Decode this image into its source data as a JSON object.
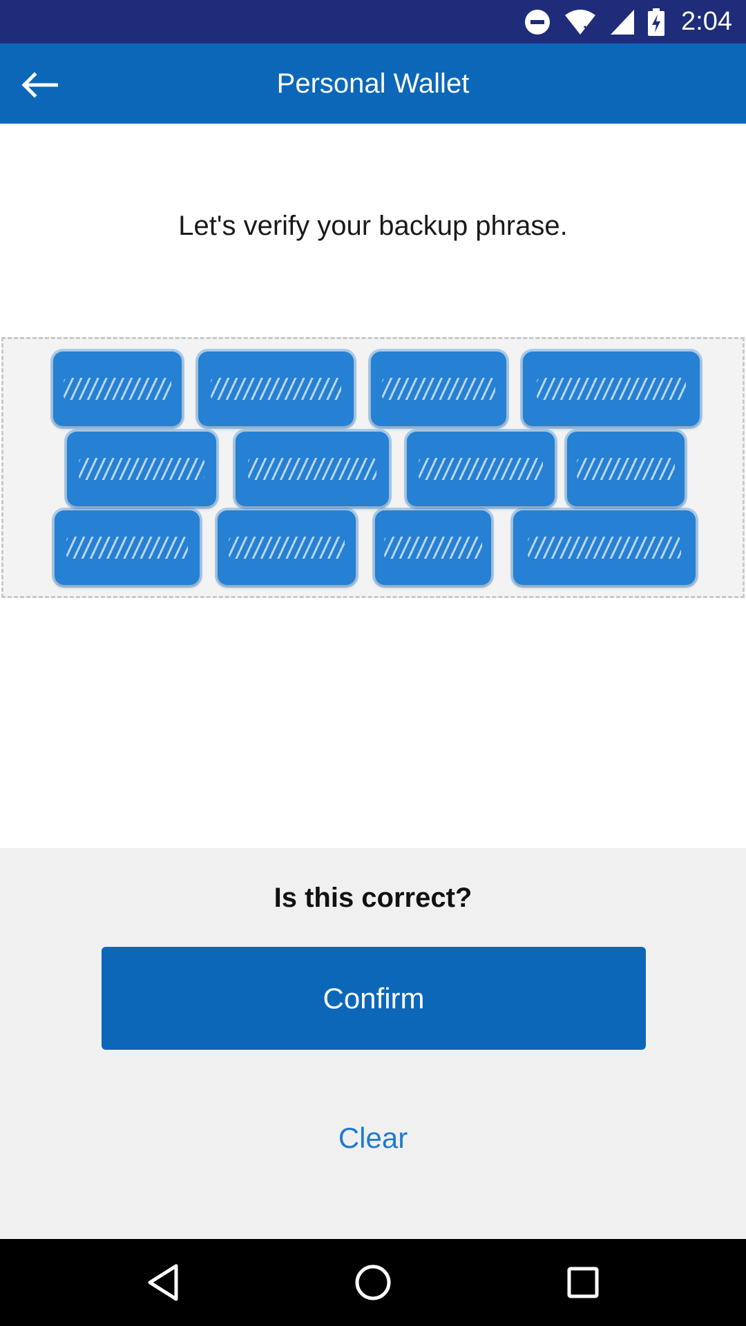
{
  "status_bar": {
    "time": "2:04",
    "icons": [
      "do-not-disturb-icon",
      "wifi-icon",
      "signal-icon",
      "battery-charging-icon"
    ]
  },
  "app_bar": {
    "title": "Personal Wallet",
    "back_icon": "back-arrow-icon"
  },
  "content": {
    "instruction": "Let's verify your backup phrase.",
    "phrase_words": {
      "rows": 3,
      "words_per_row": 4,
      "note_redacted": true
    }
  },
  "bottom_panel": {
    "question": "Is this correct?",
    "confirm_label": "Confirm",
    "clear_label": "Clear"
  },
  "navigation": {
    "back_icon": "nav-back-icon",
    "home_icon": "nav-home-icon",
    "recents_icon": "nav-recents-icon"
  },
  "colors": {
    "status_bar": "#1f2c7a",
    "primary": "#0c67b8",
    "chip": "#2680d3",
    "link": "#1f7ad0",
    "panel_bg": "#f0f0f0"
  }
}
